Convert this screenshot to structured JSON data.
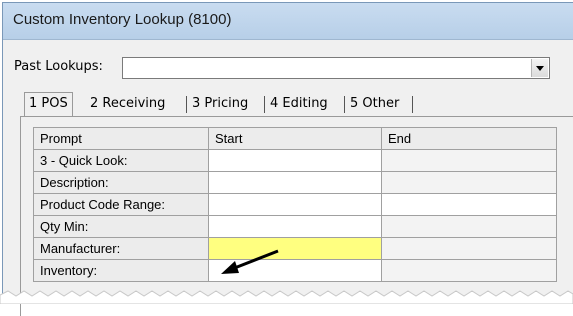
{
  "window": {
    "title": "Custom Inventory Lookup (8100)"
  },
  "past_lookups": {
    "label": "Past Lookups:",
    "value": ""
  },
  "tabs": [
    {
      "label": "1 POS",
      "active": true
    },
    {
      "label": "2 Receiving",
      "active": false
    },
    {
      "label": "3 Pricing",
      "active": false
    },
    {
      "label": "4 Editing",
      "active": false
    },
    {
      "label": "5 Other",
      "active": false
    }
  ],
  "grid": {
    "columns": [
      "Prompt",
      "Start",
      "End"
    ],
    "rows": [
      {
        "prompt": "3 - Quick Look:",
        "start": "",
        "end": ""
      },
      {
        "prompt": "Description:",
        "start": "",
        "end": ""
      },
      {
        "prompt": "Product Code Range:",
        "start": "",
        "end": ""
      },
      {
        "prompt": "Qty Min:",
        "start": "",
        "end": ""
      },
      {
        "prompt": "Manufacturer:",
        "start": "",
        "end": ""
      },
      {
        "prompt": "Inventory:",
        "start": "",
        "end": ""
      }
    ]
  },
  "colors": {
    "highlight": "#ffff80",
    "arrow": "#000000"
  },
  "icons": {
    "dropdown": "chevron-down-icon",
    "pointer": "arrow-icon"
  }
}
